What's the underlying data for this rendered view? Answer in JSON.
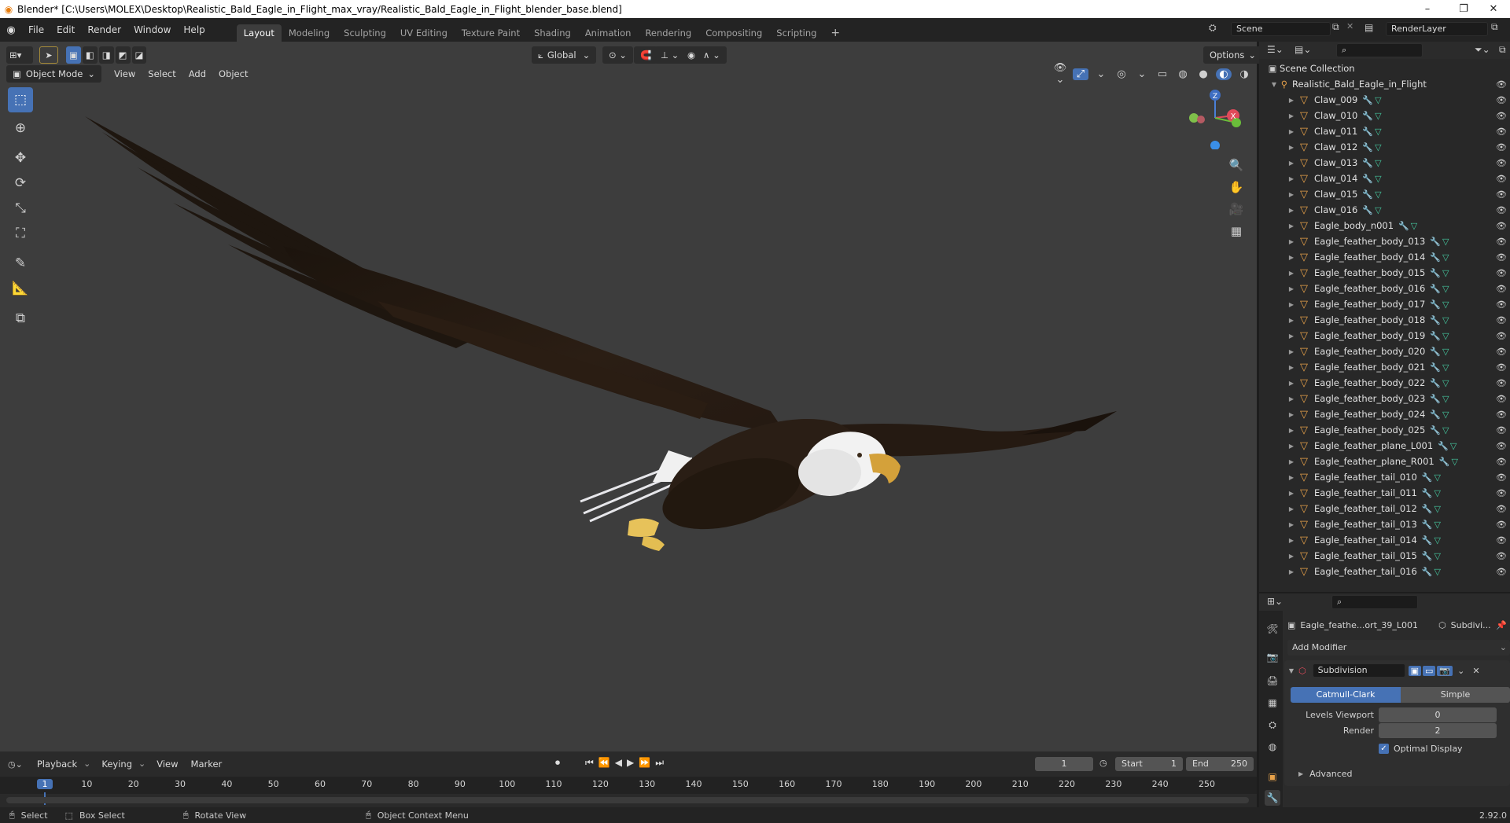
{
  "window": {
    "title": "Blender* [C:\\Users\\MOLEX\\Desktop\\Realistic_Bald_Eagle_in_Flight_max_vray/Realistic_Bald_Eagle_in_Flight_blender_base.blend]",
    "minimize": "–",
    "restore": "❐",
    "close": "✕"
  },
  "menu": [
    "File",
    "Edit",
    "Render",
    "Window",
    "Help"
  ],
  "workspaces": [
    {
      "label": "Layout",
      "active": true
    },
    {
      "label": "Modeling"
    },
    {
      "label": "Sculpting"
    },
    {
      "label": "UV Editing"
    },
    {
      "label": "Texture Paint"
    },
    {
      "label": "Shading"
    },
    {
      "label": "Animation"
    },
    {
      "label": "Rendering"
    },
    {
      "label": "Compositing"
    },
    {
      "label": "Scripting"
    }
  ],
  "add_workspace": "+",
  "scene": {
    "label": "Scene",
    "render_layer": "RenderLayer"
  },
  "viewport": {
    "mode": "Object Mode",
    "menus": [
      "View",
      "Select",
      "Add",
      "Object"
    ],
    "orientation": "Global",
    "options": "Options",
    "gizmo": {
      "z": "Z",
      "x": "X"
    }
  },
  "outliner": {
    "root": "Scene Collection",
    "collection": "Realistic_Bald_Eagle_in_Flight",
    "items": [
      "Claw_009",
      "Claw_010",
      "Claw_011",
      "Claw_012",
      "Claw_013",
      "Claw_014",
      "Claw_015",
      "Claw_016",
      "Eagle_body_n001",
      "Eagle_feather_body_013",
      "Eagle_feather_body_014",
      "Eagle_feather_body_015",
      "Eagle_feather_body_016",
      "Eagle_feather_body_017",
      "Eagle_feather_body_018",
      "Eagle_feather_body_019",
      "Eagle_feather_body_020",
      "Eagle_feather_body_021",
      "Eagle_feather_body_022",
      "Eagle_feather_body_023",
      "Eagle_feather_body_024",
      "Eagle_feather_body_025",
      "Eagle_feather_plane_L001",
      "Eagle_feather_plane_R001",
      "Eagle_feather_tail_010",
      "Eagle_feather_tail_011",
      "Eagle_feather_tail_012",
      "Eagle_feather_tail_013",
      "Eagle_feather_tail_014",
      "Eagle_feather_tail_015",
      "Eagle_feather_tail_016"
    ]
  },
  "properties": {
    "object_name": "Eagle_feathe...ort_39_L001",
    "modifier_short": "Subdivi...",
    "add_modifier": "Add Modifier",
    "modifier_name": "Subdivision",
    "catmull": "Catmull-Clark",
    "simple": "Simple",
    "levels_label": "Levels Viewport",
    "levels_value": "0",
    "render_label": "Render",
    "render_value": "2",
    "optimal": "Optimal Display",
    "advanced": "Advanced"
  },
  "timeline": {
    "menus": [
      "Playback",
      "Keying",
      "View",
      "Marker"
    ],
    "current_frame": "1",
    "start_label": "Start",
    "start": "1",
    "end_label": "End",
    "end": "250",
    "ruler": [
      "1",
      "10",
      "20",
      "30",
      "40",
      "50",
      "60",
      "70",
      "80",
      "90",
      "100",
      "110",
      "120",
      "130",
      "140",
      "150",
      "160",
      "170",
      "180",
      "190",
      "200",
      "210",
      "220",
      "230",
      "240",
      "250"
    ]
  },
  "status": {
    "select": "Select",
    "box_select": "Box Select",
    "rotate": "Rotate View",
    "context": "Object Context Menu",
    "version": "2.92.0"
  },
  "colors": {
    "accent": "#4672b5",
    "viewport_bg": "#3d3d3d",
    "panel_bg": "#282828",
    "object_orange": "#e8a24a",
    "mesh_green": "#45c9a0"
  }
}
